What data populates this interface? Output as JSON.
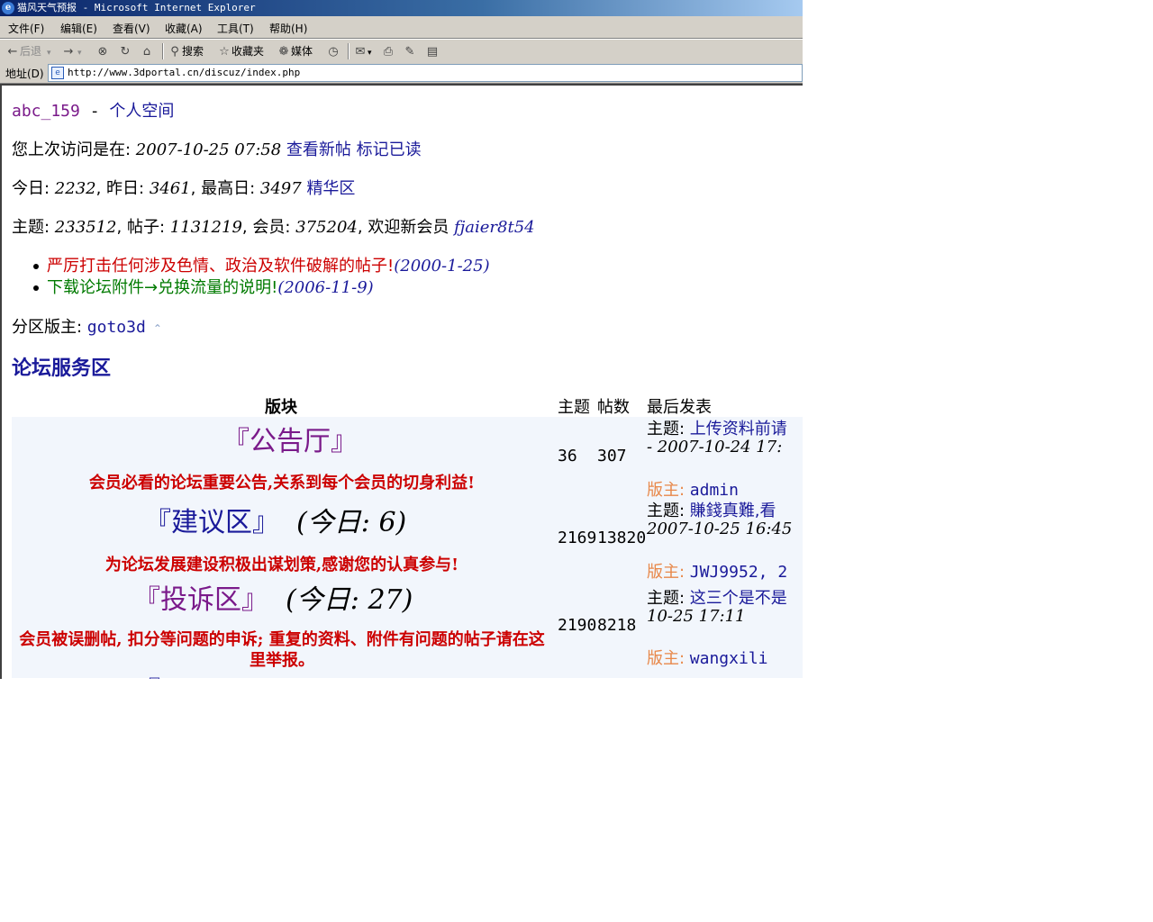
{
  "window": {
    "title": "猫风天气预报 - Microsoft Internet Explorer"
  },
  "menubar": [
    "文件(F)",
    "编辑(E)",
    "查看(V)",
    "收藏(A)",
    "工具(T)",
    "帮助(H)"
  ],
  "toolbar": {
    "back": "后退",
    "search": "搜索",
    "favorites": "收藏夹",
    "media": "媒体"
  },
  "address": {
    "label": "地址(D)",
    "url": "http://www.3dportal.cn/discuz/index.php"
  },
  "page": {
    "user": "abc_159",
    "user_sep": " - ",
    "space_link": "个人空间",
    "last_visit_label": "您上次访问是在: ",
    "last_visit": "2007-10-25 07:58",
    "view_new": "查看新帖",
    "mark_read": "标记已读",
    "today_label": "今日: ",
    "today": "2232",
    "yesterday_label": ", 昨日: ",
    "yesterday": "3461",
    "max_label": ", 最高日: ",
    "max": "3497",
    "digest": "精华区",
    "threads_label": "主题: ",
    "threads": "233512",
    "posts_label": ", 帖子: ",
    "posts": "1131219",
    "members_label": ", 会员: ",
    "members": "375204",
    "welcome_label": ", 欢迎新会员 ",
    "new_member": "fjaier8t54",
    "announcements": [
      {
        "text": "严厉打击任何涉及色情、政治及软件破解的帖子!",
        "date": "(2000-1-25)"
      },
      {
        "text": "下载论坛附件→兑换流量的说明!",
        "date": "(2006-11-9)"
      }
    ],
    "zone_mod_label": "分区版主: ",
    "zone_mod": "goto3d",
    "section_title": "论坛服务区"
  },
  "table": {
    "headers": {
      "forum": "版块",
      "threads": "主题",
      "posts": "帖数",
      "last": "最后发表"
    },
    "rows": [
      {
        "name": "『公告厅』",
        "today_label": "",
        "today": "",
        "desc": "会员必看的论坛重要公告,关系到每个会员的切身利益!",
        "threads": "36",
        "posts": "307",
        "last_label": "主题: ",
        "last_title": "上传资料前请",
        "last_date": "- 2007-10-24 17:",
        "mod_label": "版主: ",
        "mods": "admin"
      },
      {
        "name": "『建议区』",
        "today_label": "(今日: ",
        "today": "6",
        "today_close": ")",
        "desc": "为论坛发展建设积极出谋划策,感谢您的认真参与!",
        "threads": "2169",
        "posts": "13820",
        "last_label": "主题: ",
        "last_title": "賺錢真難,看",
        "last_date": "2007-10-25 16:45",
        "mod_label": "版主: ",
        "mods": "JWJ9952, 2"
      },
      {
        "name": "『投诉区』",
        "today_label": "(今日: ",
        "today": "27",
        "today_close": ")",
        "desc": "会员被误删帖, 扣分等问题的申诉; 重复的资料、附件有问题的帖子请在这里举报。",
        "threads": "2190",
        "posts": "8218",
        "last_label": "主题: ",
        "last_title": "这三个是不是",
        "last_date": "10-25 17:11",
        "mod_label": "版主: ",
        "mods": "wangxili"
      }
    ]
  },
  "colors": {
    "titlebar": "#0a246a",
    "link": "#1a1a9a",
    "forum_name_purple": "#7a1a8a",
    "forum_name_blue": "#1a1a9a",
    "desc_red": "#cc0000",
    "today_orange": "#e8884a",
    "notice_green": "#007a00"
  }
}
